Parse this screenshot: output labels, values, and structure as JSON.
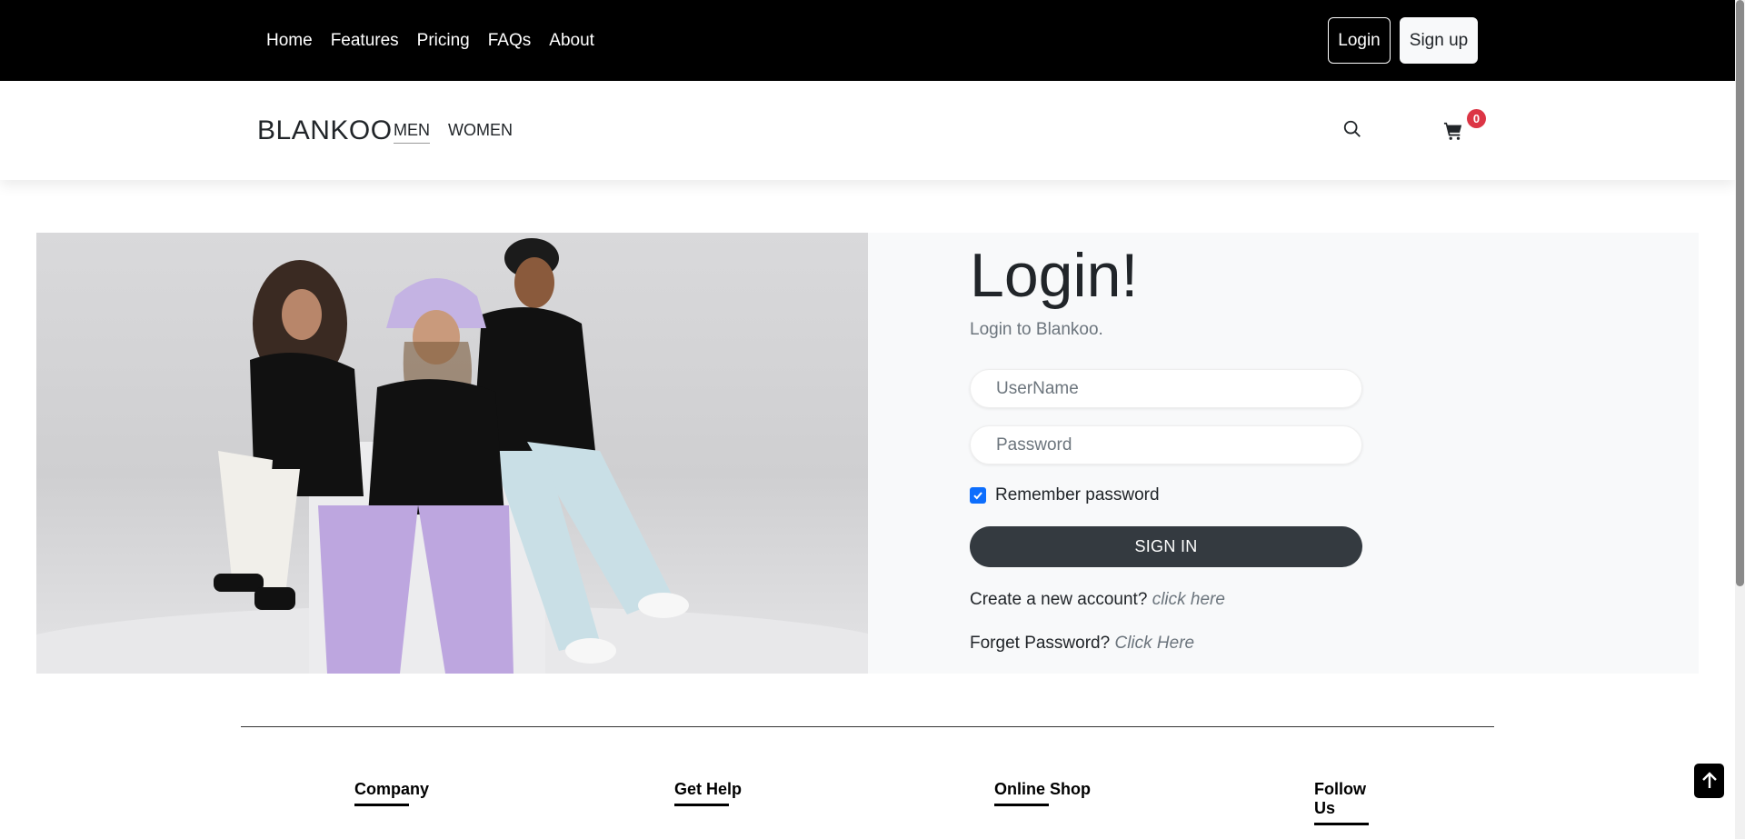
{
  "topbar": {
    "nav": [
      "Home",
      "Features",
      "Pricing",
      "FAQs",
      "About"
    ],
    "login_label": "Login",
    "signup_label": "Sign up"
  },
  "header": {
    "brand": "BLANKOO",
    "categories": [
      "MEN",
      "WOMEN"
    ],
    "cart_count": "0"
  },
  "login": {
    "title": "Login!",
    "subtitle": "Login to Blankoo.",
    "username_placeholder": "UserName",
    "password_placeholder": "Password",
    "remember_label": "Remember password",
    "remember_checked": true,
    "signin_label": "SIGN IN",
    "create_text": "Create a new account?",
    "create_link": "click here",
    "forget_text": "Forget Password?",
    "forget_link": "Click Here"
  },
  "footer": {
    "columns": [
      "Company",
      "Get Help",
      "Online Shop",
      "Follow Us"
    ]
  },
  "colors": {
    "topbar_bg": "#000000",
    "signin_bg": "#343a40",
    "badge": "#dc3545",
    "checkbox": "#0d6efd"
  },
  "icons": [
    "search-icon",
    "cart-icon",
    "check-icon",
    "arrow-up-icon"
  ]
}
